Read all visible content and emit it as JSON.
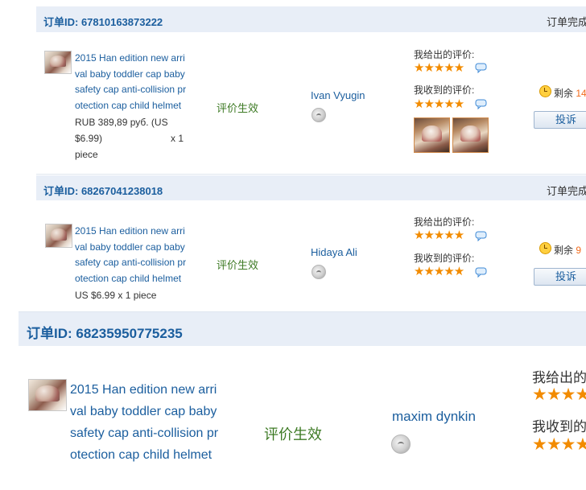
{
  "orders": [
    {
      "id_label": "订单ID: 67810163873222",
      "status": "订单完成",
      "product_lines": [
        "2015 Han edition new arri",
        "val baby toddler cap baby",
        "safety cap anti-collision pr",
        "otection cap child helmet"
      ],
      "price_line1": "RUB 389,89 руб. (US",
      "price_line2": "$6.99)",
      "qty": "x 1",
      "unit": "piece",
      "feedback_status": "评价生效",
      "buyer": "Ivan Vyugin",
      "given_label": "我给出的评价:",
      "received_label": "我收到的评价:",
      "stars": "★★★★★",
      "remain_label": "剩余",
      "remain_value": "14",
      "complain": "投诉"
    },
    {
      "id_label": "订单ID: 68267041238018",
      "status": "订单完成",
      "product_lines": [
        "2015 Han edition new arri",
        "val baby toddler cap baby",
        "safety cap anti-collision pr",
        "otection cap child helmet"
      ],
      "price_line": "US $6.99 x 1 piece",
      "feedback_status": "评价生效",
      "buyer": "Hidaya Ali",
      "given_label": "我给出的评价:",
      "received_label": "我收到的评价:",
      "stars": "★★★★★",
      "remain_label": "剩余",
      "remain_value": "9",
      "complain": "投诉"
    },
    {
      "id_label": "订单ID: 68235950775235",
      "product_lines": [
        "2015 Han edition new arri",
        "val baby toddler cap baby",
        "safety cap anti-collision pr",
        "otection cap child helmet"
      ],
      "feedback_status": "评价生效",
      "buyer": "maxim dynkin",
      "given_label": "我给出的",
      "received_label": "我收到的",
      "stars": "★★★★"
    }
  ],
  "colors": {
    "header_bg": "#e8eef7",
    "link": "#1b5e9e",
    "green": "#3d7a24",
    "star": "#f28b00",
    "remain_num": "#f26b1d"
  },
  "icons": {
    "comment": "comment-bubble-icon",
    "clock": "clock-icon",
    "avatar": "avatar-placeholder-icon"
  }
}
